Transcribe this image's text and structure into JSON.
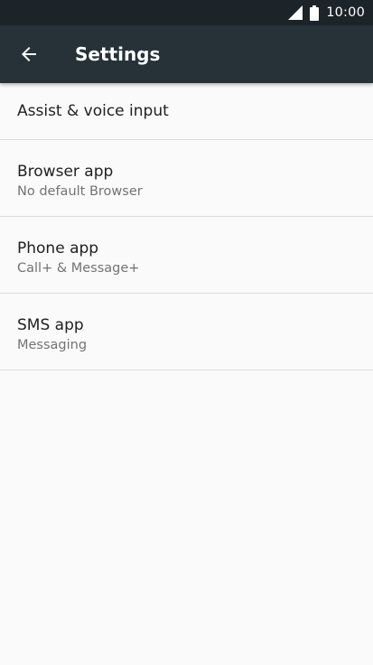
{
  "status_bar": {
    "time": "10:00",
    "signal_icon": "cell-signal-icon",
    "battery_icon": "battery-icon"
  },
  "toolbar": {
    "title": "Settings",
    "back_icon": "arrow-back-icon"
  },
  "list": {
    "items": [
      {
        "title": "Assist & voice input",
        "subtitle": ""
      },
      {
        "title": "Browser app",
        "subtitle": "No default Browser"
      },
      {
        "title": "Phone app",
        "subtitle": "Call+ & Message+"
      },
      {
        "title": "SMS app",
        "subtitle": "Messaging"
      }
    ]
  },
  "colors": {
    "status_bar_bg": "#1c2329",
    "toolbar_bg": "#263238",
    "background": "#fafafa",
    "divider": "#dcdcdc",
    "primary_text": "#212121",
    "secondary_text": "#737373"
  }
}
